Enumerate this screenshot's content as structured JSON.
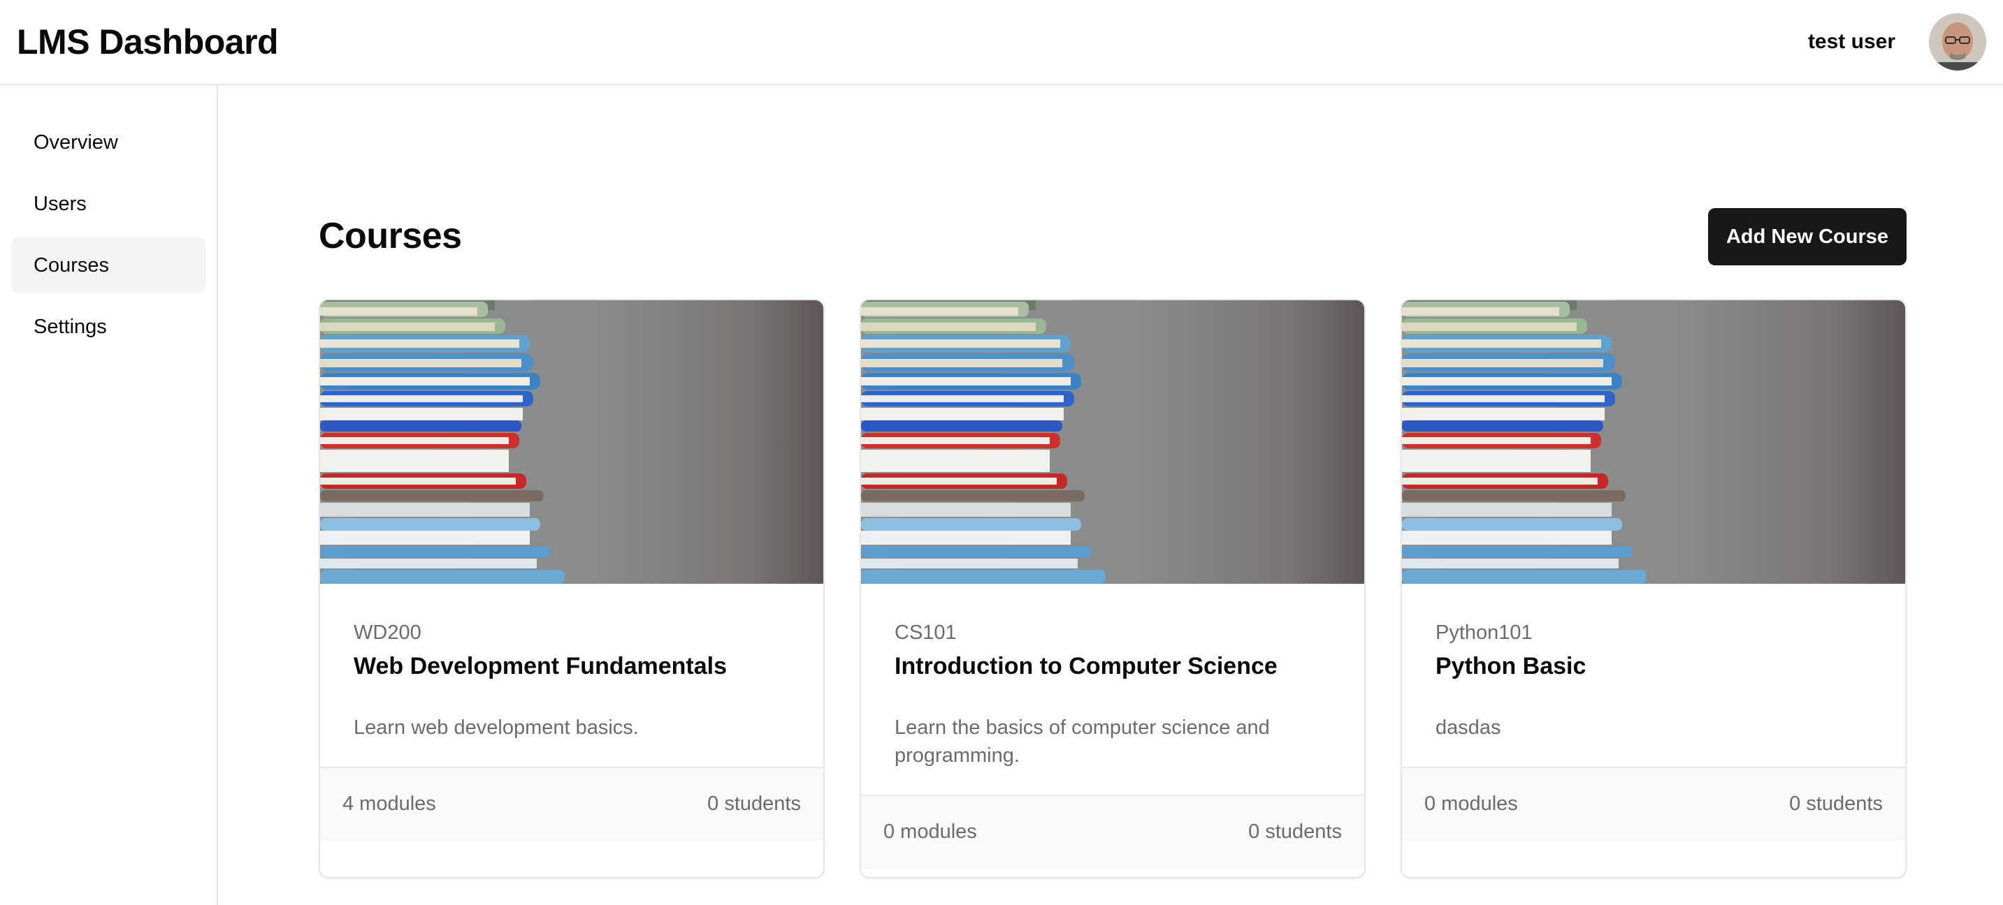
{
  "header": {
    "title": "LMS Dashboard",
    "user_name": "test user",
    "avatar_icon": "user-avatar-photo"
  },
  "sidebar": {
    "items": [
      {
        "label": "Overview",
        "active": false
      },
      {
        "label": "Users",
        "active": false
      },
      {
        "label": "Courses",
        "active": true
      },
      {
        "label": "Settings",
        "active": false
      }
    ]
  },
  "main": {
    "title": "Courses",
    "add_button_label": "Add New Course",
    "courses": [
      {
        "code": "WD200",
        "title": "Web Development Fundamentals",
        "description": "Learn web development basics.",
        "modules": "4 modules",
        "students": "0 students"
      },
      {
        "code": "CS101",
        "title": "Introduction to Computer Science",
        "description": "Learn the basics of computer science and programming.",
        "modules": "0 modules",
        "students": "0 students"
      },
      {
        "code": "Python101",
        "title": "Python Basic",
        "description": "dasdas",
        "modules": "0 modules",
        "students": "0 students"
      }
    ]
  },
  "colors": {
    "primary_button": "#18181b",
    "active_nav_bg": "#f4f4f5",
    "muted_text": "#6b6b6b",
    "border": "#e5e5e5"
  }
}
